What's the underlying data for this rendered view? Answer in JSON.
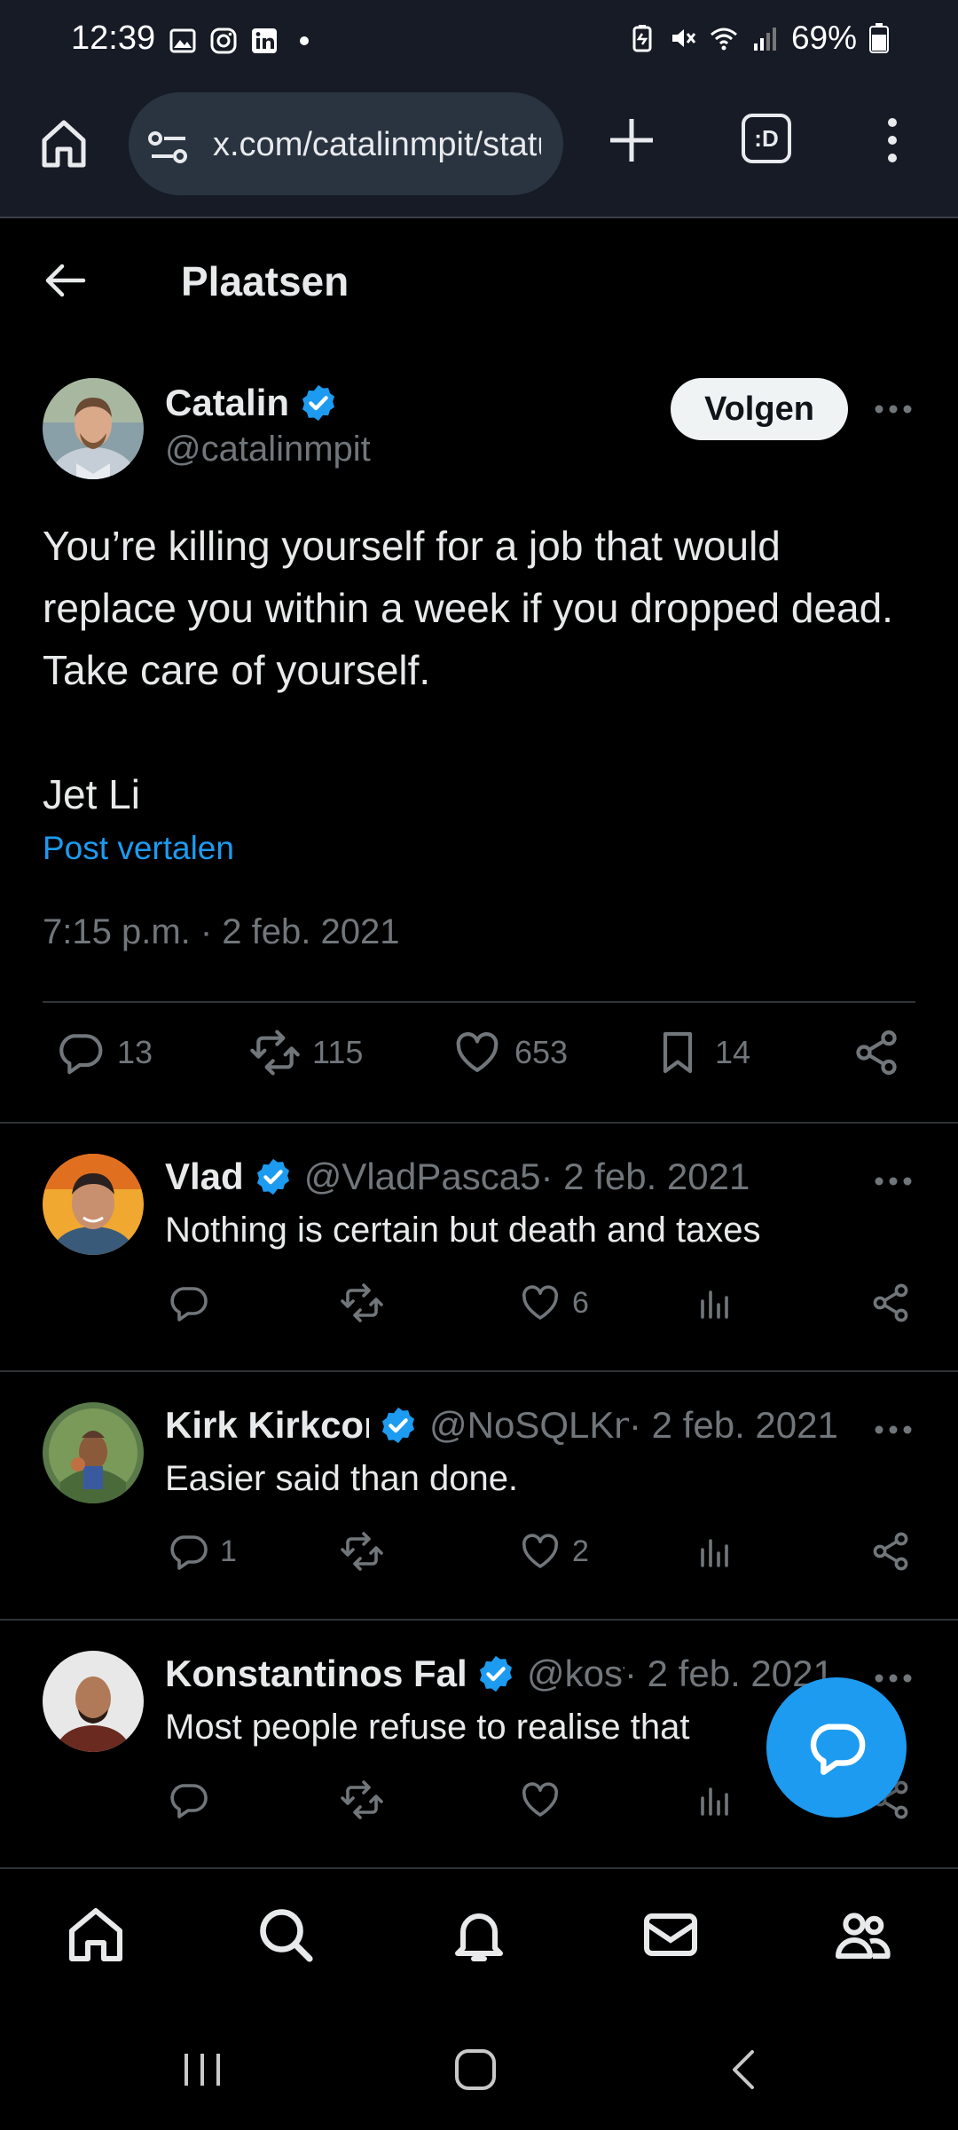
{
  "status_bar": {
    "time": "12:39",
    "battery": "69%",
    "left_icons": [
      "image-icon",
      "instagram-icon",
      "linkedin-icon",
      "dot-icon"
    ],
    "right_icons": [
      "battery-saver-icon",
      "mute-icon",
      "wifi-icon",
      "signal-icon",
      "battery-icon"
    ]
  },
  "browser": {
    "url": "x.com/catalinmpit/status/",
    "tab_label": ":D"
  },
  "header": {
    "title": "Plaatsen"
  },
  "post": {
    "author_name": "Catalin",
    "author_handle": "@catalinmpit",
    "follow_label": "Volgen",
    "text": "You’re killing yourself for a job that would replace you within a week if you dropped dead. Take care of yourself.\n\nJet Li",
    "translate_label": "Post vertalen",
    "timestamp": "7:15 p.m. · 2 feb. 2021",
    "stats": {
      "replies": "13",
      "reposts": "115",
      "likes": "653",
      "bookmarks": "14"
    }
  },
  "replies": [
    {
      "name": "Vlad",
      "handle": "@VladPasca5",
      "date": " · 2 feb. 2021",
      "text": "Nothing is certain but death and taxes",
      "reply_count": "",
      "repost_count": "",
      "like_count": "6"
    },
    {
      "name": "Kirk Kirkconnell",
      "handle": "@NoSQLKnowHow",
      "date": " · 2 feb. 2021",
      "text": "Easier said than done.",
      "reply_count": "1",
      "repost_count": "",
      "like_count": "2"
    },
    {
      "name": "Konstantinos Fal",
      "handle": "@kostasx",
      "date": " · 2 feb. 2021",
      "text": "Most people refuse to realise that",
      "reply_count": "",
      "repost_count": "",
      "like_count": ""
    }
  ],
  "colors": {
    "accent": "#1d9bf0",
    "background": "#000000",
    "text_primary": "#e7e9ea",
    "text_secondary": "#71767b",
    "divider": "#2f3336"
  }
}
